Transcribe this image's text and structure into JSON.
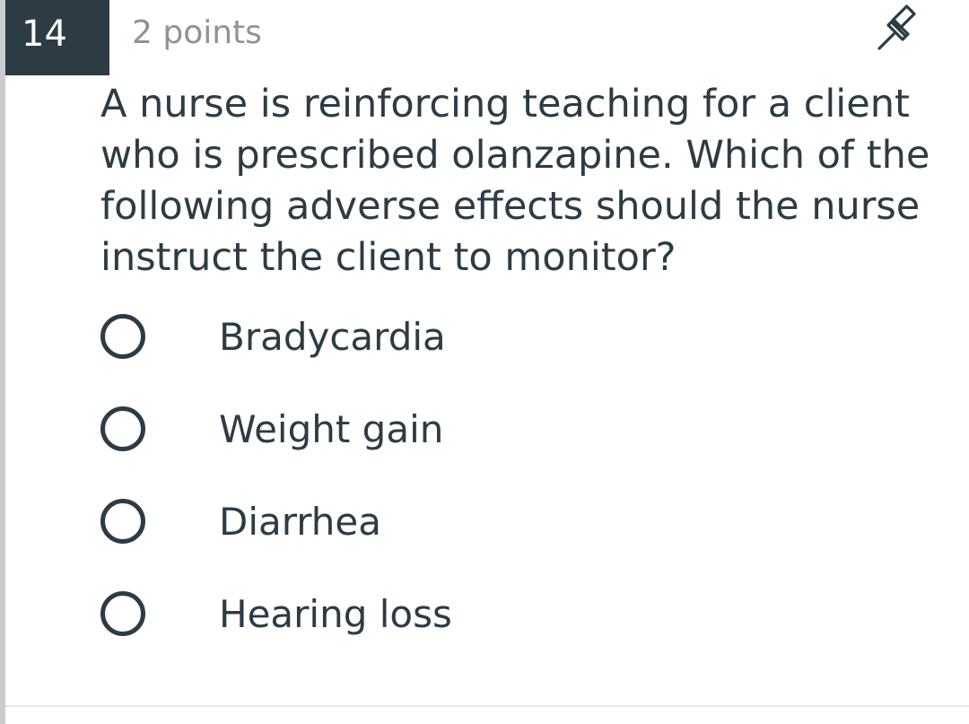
{
  "question_number": "14",
  "points_label": "2 points",
  "pin_icon": "pin-icon",
  "question_text": "A nurse is reinforcing teaching for a client who is prescribed olanzapine.  Which of the following adverse effects should the nurse instruct the client to monitor?",
  "answers": [
    {
      "label": "Bradycardia",
      "selected": false
    },
    {
      "label": "Weight gain",
      "selected": false
    },
    {
      "label": "Diarrhea",
      "selected": false
    },
    {
      "label": "Hearing loss",
      "selected": false
    }
  ],
  "colors": {
    "header_bg": "#2d3b45",
    "text": "#2d3b45",
    "muted": "#8b949a"
  }
}
